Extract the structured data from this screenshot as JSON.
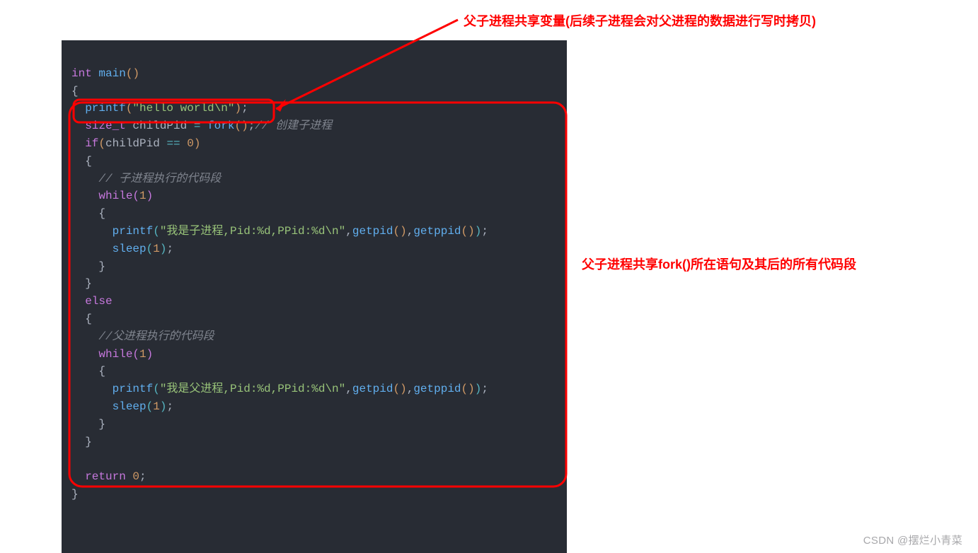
{
  "annotations": {
    "top": "父子进程共享变量(后续子进程会对父进程的数据进行写时拷贝)",
    "right": "父子进程共享fork()所在语句及其后的所有代码段"
  },
  "watermark": "CSDN @摆烂小青菜",
  "code": {
    "l1": {
      "kw_int": "int",
      "fn_main": "main",
      "p_open": "(",
      "p_close": ")"
    },
    "l2": {
      "brace": "{"
    },
    "l3": {
      "fn_printf": "printf",
      "p_open": "(",
      "str": "\"hello world\\n\"",
      "p_close": ")"
    },
    "l4": {
      "type": "size_t",
      "var": "childPid",
      "eq": "=",
      "fn_fork": "fork",
      "p_open": "(",
      "p_close": ")",
      "comment": "// 创建子进程"
    },
    "l5": {
      "kw_if": "if",
      "p_open": "(",
      "var": "childPid",
      "op": "==",
      "num": "0",
      "p_close": ")"
    },
    "l6": {
      "brace": "{"
    },
    "l7": {
      "comment": "// 子进程执行的代码段"
    },
    "l8": {
      "kw_while": "while",
      "p_open": "(",
      "num": "1",
      "p_close": ")"
    },
    "l9": {
      "brace": "{"
    },
    "l10": {
      "fn_printf": "printf",
      "p_open": "(",
      "str": "\"我是子进程,Pid:%d,PPid:%d\\n\"",
      "comma1": ",",
      "fn_getpid": "getpid",
      "p2_open": "(",
      "p2_close": ")",
      "comma2": ",",
      "fn_getppid": "getppid",
      "p3_open": "(",
      "p3_close": ")",
      "p_close": ")"
    },
    "l11": {
      "fn_sleep": "sleep",
      "p_open": "(",
      "num": "1",
      "p_close": ")"
    },
    "l12": {
      "brace": "}"
    },
    "l13": {
      "brace": "}"
    },
    "l14": {
      "kw_else": "else"
    },
    "l15": {
      "brace": "{"
    },
    "l16": {
      "comment": "//父进程执行的代码段"
    },
    "l17": {
      "kw_while": "while",
      "p_open": "(",
      "num": "1",
      "p_close": ")"
    },
    "l18": {
      "brace": "{"
    },
    "l19": {
      "fn_printf": "printf",
      "p_open": "(",
      "str": "\"我是父进程,Pid:%d,PPid:%d\\n\"",
      "comma1": ",",
      "fn_getpid": "getpid",
      "p2_open": "(",
      "p2_close": ")",
      "comma2": ",",
      "fn_getppid": "getppid",
      "p3_open": "(",
      "p3_close": ")",
      "p_close": ")"
    },
    "l20": {
      "fn_sleep": "sleep",
      "p_open": "(",
      "num": "1",
      "p_close": ")"
    },
    "l21": {
      "brace": "}"
    },
    "l22": {
      "brace": "}"
    },
    "l24": {
      "kw_return": "return",
      "num": "0"
    },
    "l25": {
      "brace": "}"
    }
  }
}
